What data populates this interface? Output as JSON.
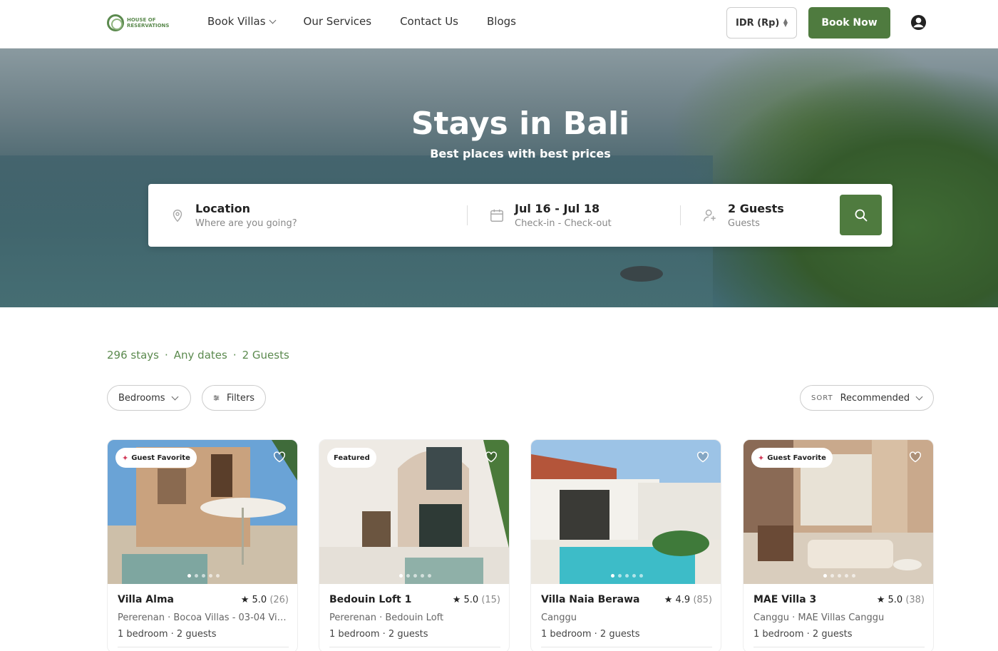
{
  "nav": {
    "logo_text": "HOUSE OF RESERVATIONS",
    "links": [
      "Book Villas",
      "Our Services",
      "Contact Us",
      "Blogs"
    ],
    "currency": "IDR (Rp)",
    "book_now": "Book Now",
    "accent_color": "#4f7b3f"
  },
  "hero": {
    "title": "Stays in Bali",
    "subtitle": "Best places with best prices",
    "search": {
      "location_label": "Location",
      "location_placeholder": "Where are you going?",
      "dates_label": "Jul 16 - Jul 18",
      "dates_sub": "Check-in - Check-out",
      "guests_label": "2 Guests",
      "guests_sub": "Guests",
      "location_icon": "map-pin-icon",
      "dates_icon": "calendar-icon",
      "guests_icon": "add-user-icon",
      "button_icon": "search-icon"
    }
  },
  "results": {
    "count": "296 stays",
    "dates": "Any dates",
    "guests": "2 Guests",
    "filters": {
      "bedrooms": "Bedrooms",
      "filters": "Filters",
      "sort_key": "SORT",
      "sort_value": "Recommended"
    }
  },
  "cards": [
    {
      "badge": "Guest Favorite",
      "name": "Villa Alma",
      "rating": "5.0",
      "reviews": "(26)",
      "location": "Pererenan · Bocoa Villas - 03-04 Vill...",
      "meta": "1 bedroom · 2 guests"
    },
    {
      "badge": "Featured",
      "name": "Bedouin Loft 1",
      "rating": "5.0",
      "reviews": "(15)",
      "location": "Pererenan · Bedouin Loft",
      "meta": "1 bedroom · 2 guests"
    },
    {
      "badge": "",
      "name": "Villa Naia Berawa",
      "rating": "4.9",
      "reviews": "(85)",
      "location": "Canggu",
      "meta": "1 bedroom · 2 guests"
    },
    {
      "badge": "Guest Favorite",
      "name": "MAE Villa 3",
      "rating": "5.0",
      "reviews": "(38)",
      "location": "Canggu · MAE Villas Canggu",
      "meta": "1 bedroom · 2 guests"
    }
  ]
}
